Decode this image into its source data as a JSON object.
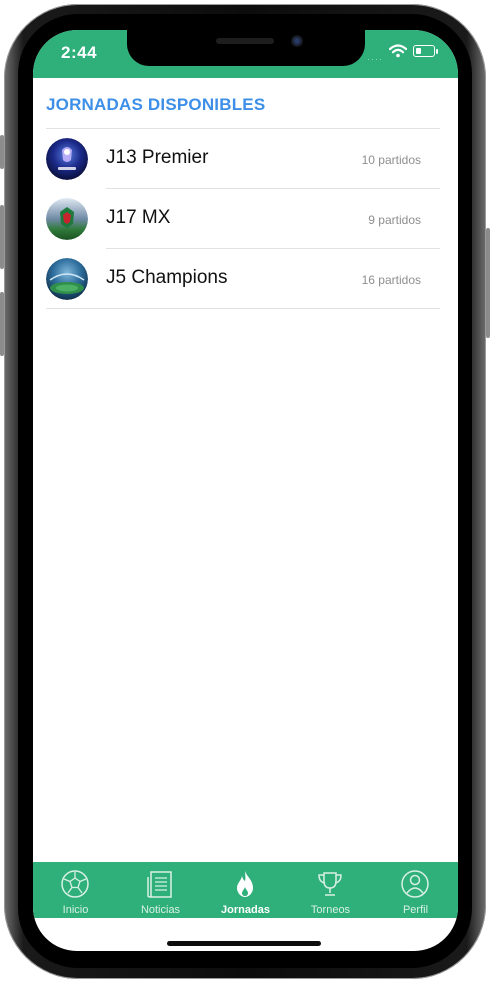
{
  "status_bar": {
    "time": "2:44",
    "signal_dots": "····"
  },
  "section": {
    "title": "JORNADAS DISPONIBLES"
  },
  "jornadas": [
    {
      "name": "J13 Premier",
      "count": "10 partidos",
      "icon": "premier-league-avatar"
    },
    {
      "name": "J17 MX",
      "count": "9 partidos",
      "icon": "liga-mx-avatar"
    },
    {
      "name": "J5 Champions",
      "count": "16 partidos",
      "icon": "champions-stadium-avatar"
    }
  ],
  "tab_bar": {
    "active": "Jornadas",
    "tabs": [
      {
        "label": "Inicio",
        "icon": "soccer-ball-icon"
      },
      {
        "label": "Noticias",
        "icon": "newspaper-icon"
      },
      {
        "label": "Jornadas",
        "icon": "flame-icon"
      },
      {
        "label": "Torneos",
        "icon": "trophy-icon"
      },
      {
        "label": "Perfil",
        "icon": "profile-icon"
      }
    ]
  },
  "colors": {
    "primary_green": "#2fb07b",
    "title_blue": "#3d8fe8",
    "count_gray": "#8e8e8e"
  }
}
